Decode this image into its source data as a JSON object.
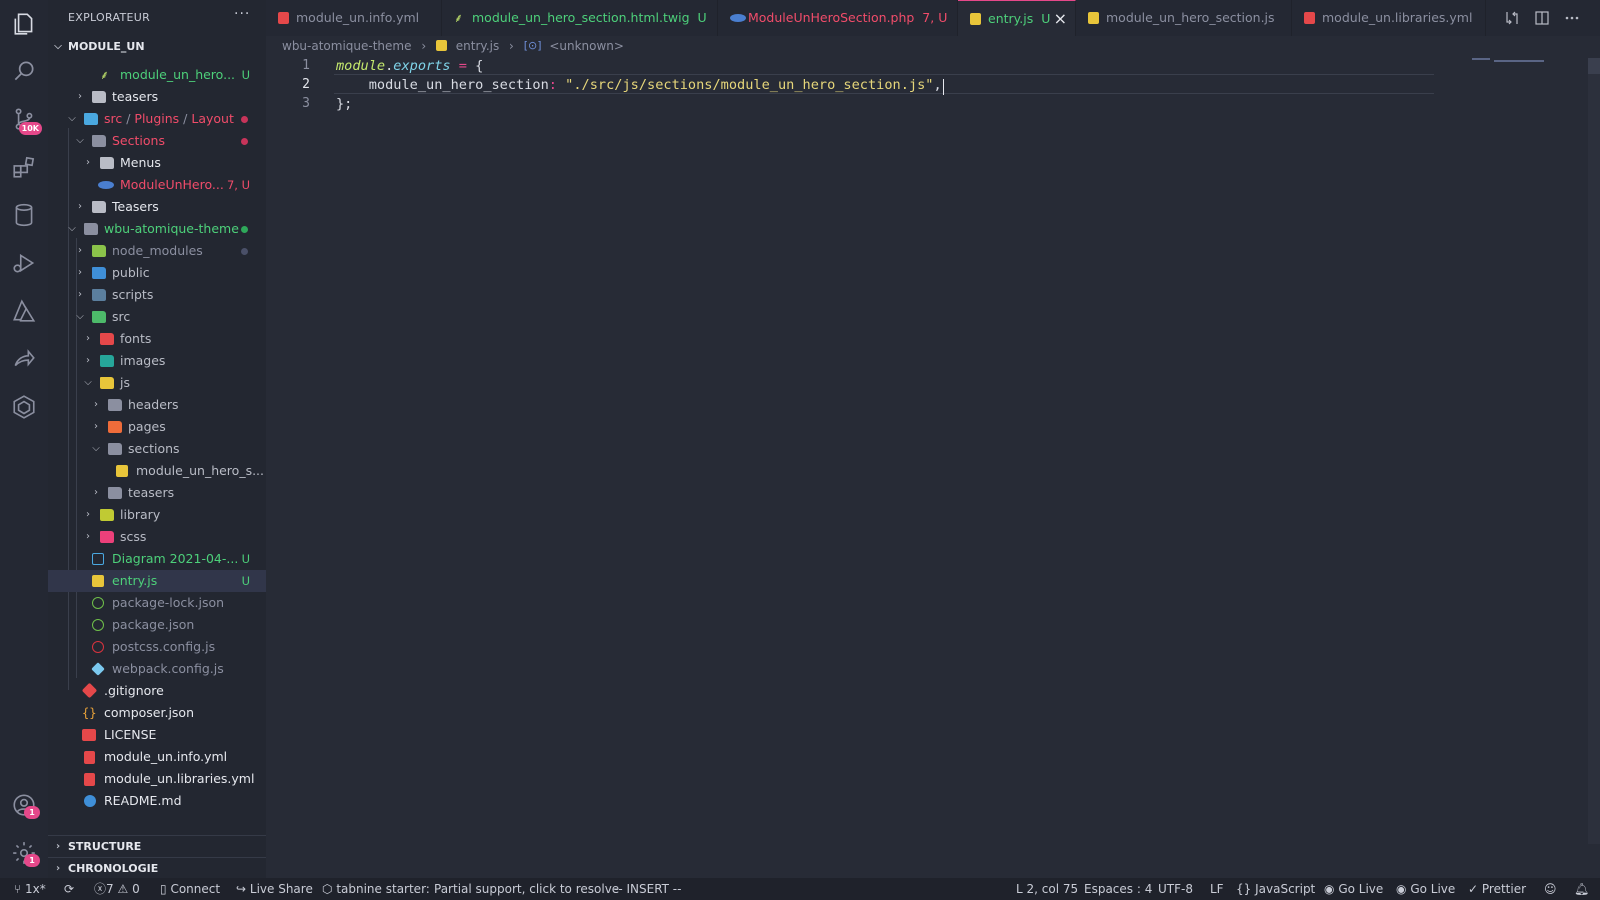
{
  "sidebar": {
    "title": "EXPLORATEUR",
    "more": "···",
    "root": "MODULE_UN",
    "rows": [
      {
        "label": "module_un_hero...",
        "badge": "U"
      },
      {
        "label": "teasers"
      },
      {
        "label_parts": [
          "src",
          "Plugins",
          "Layout"
        ]
      },
      {
        "label": "Sections"
      },
      {
        "label": "Menus"
      },
      {
        "label": "ModuleUnHero...",
        "badge": "7, U"
      },
      {
        "label": "Teasers"
      },
      {
        "label": "wbu-atomique-theme"
      },
      {
        "label": "node_modules"
      },
      {
        "label": "public"
      },
      {
        "label": "scripts"
      },
      {
        "label": "src"
      },
      {
        "label": "fonts"
      },
      {
        "label": "images"
      },
      {
        "label": "js"
      },
      {
        "label": "headers"
      },
      {
        "label": "pages"
      },
      {
        "label": "sections"
      },
      {
        "label": "module_un_hero_s..."
      },
      {
        "label": "teasers"
      },
      {
        "label": "library"
      },
      {
        "label": "scss"
      },
      {
        "label": "Diagram 2021-04-...",
        "badge": "U"
      },
      {
        "label": "entry.js",
        "badge": "U"
      },
      {
        "label": "package-lock.json"
      },
      {
        "label": "package.json"
      },
      {
        "label": "postcss.config.js"
      },
      {
        "label": "webpack.config.js"
      },
      {
        "label": ".gitignore"
      },
      {
        "label": "composer.json"
      },
      {
        "label": "LICENSE"
      },
      {
        "label": "module_un.info.yml"
      },
      {
        "label": "module_un.libraries.yml"
      },
      {
        "label": "README.md"
      }
    ],
    "structure": "STRUCTURE",
    "chronologie": "CHRONOLOGIE"
  },
  "activity": {
    "scm_badge": "10K",
    "accounts_badge": "1",
    "settings_badge": "1"
  },
  "tabs": [
    {
      "label": "module_un.info.yml"
    },
    {
      "label": "module_un_hero_section.html.twig",
      "badge": "U"
    },
    {
      "label": "ModuleUnHeroSection.php",
      "badge": "7, U"
    },
    {
      "label": "entry.js",
      "badge": "U",
      "close": "×"
    },
    {
      "label": "module_un_hero_section.js"
    },
    {
      "label": "module_un.libraries.yml"
    }
  ],
  "breadcrumb": {
    "folder": "wbu-atomique-theme",
    "file": "entry.js",
    "symbol": "<unknown>"
  },
  "editor": {
    "lines": [
      {
        "num": "1",
        "tokens": [
          {
            "t": "module",
            "c": "#c4e86d",
            "i": true
          },
          {
            "t": ".",
            "c": "#d8dbe3"
          },
          {
            "t": "exports",
            "c": "#7fd3e8",
            "i": true
          },
          {
            "t": " = ",
            "c": "#e5488a"
          },
          {
            "t": "{",
            "c": "#d8dbe3"
          }
        ]
      },
      {
        "num": "2",
        "tokens": [
          {
            "t": "    module_un_hero_section",
            "c": "#d8dbe3"
          },
          {
            "t": ": ",
            "c": "#e5488a"
          },
          {
            "t": "\"./src/js/sections/module_un_hero_section.js\"",
            "c": "#e6d67a"
          },
          {
            "t": ",",
            "c": "#d8dbe3"
          }
        ]
      },
      {
        "num": "3",
        "tokens": [
          {
            "t": "};",
            "c": "#d8dbe3"
          }
        ]
      }
    ]
  },
  "status": {
    "branch": "1x*",
    "errors": "7",
    "warnings": "0",
    "connect": "Connect",
    "live_share": "Live Share",
    "tabnine": "tabnine starter:",
    "partial": "Partial support, click to resolve",
    "mode": "-- INSERT --",
    "position": "L 2, col 75",
    "spaces": "Espaces : 4",
    "encoding": "UTF-8",
    "eol": "LF",
    "language": "JavaScript",
    "golive1": "Go Live",
    "golive2": "Go Live",
    "prettier": "Prettier"
  },
  "colors": {
    "accent": "#e5488a",
    "untracked": "#4dd07a",
    "modified_red": "#f14c6a",
    "editor_bg": "#272b36"
  }
}
